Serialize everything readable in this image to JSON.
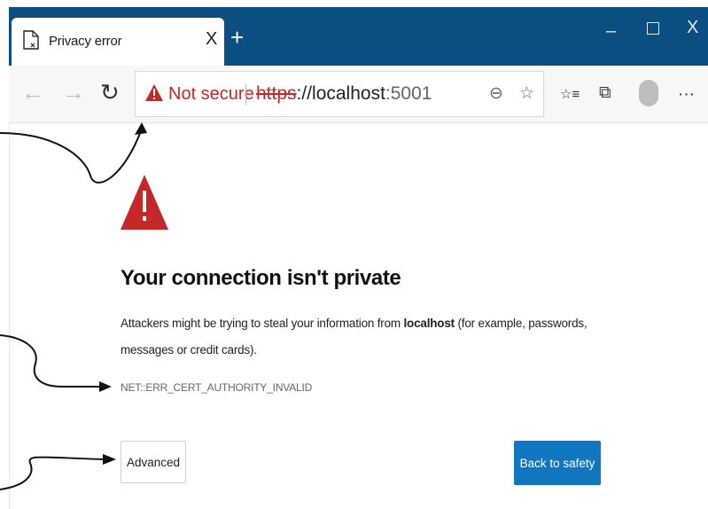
{
  "window": {
    "tab_title": "Privacy error",
    "tab_close": "X",
    "new_tab": "+",
    "minimize": "–",
    "close": "X",
    "background_color": "#0b4f82"
  },
  "toolbar": {
    "back_icon": "←",
    "forward_icon": "→",
    "refresh_icon": "↻",
    "not_secure_label": "Not secure",
    "url_scheme": "https",
    "url_host": "://localhost",
    "url_port": ":5001",
    "zoom_icon": "⊖",
    "favorite_icon": "☆",
    "favorites_icon": "☆≡",
    "collections_icon": "⧉",
    "more_icon": "···"
  },
  "page": {
    "heading": "Your connection isn't private",
    "description_before": "Attackers might be trying to steal your information from ",
    "description_host": "localhost",
    "description_after": " (for example, passwords, messages or credit cards).",
    "error_code": "NET::ERR_CERT_AUTHORITY_INVALID",
    "advanced_button": "Advanced",
    "back_button": "Back to safety",
    "warning_glyph": "!"
  },
  "colors": {
    "warning_red": "#c62828",
    "primary_button": "#0f76bf"
  }
}
